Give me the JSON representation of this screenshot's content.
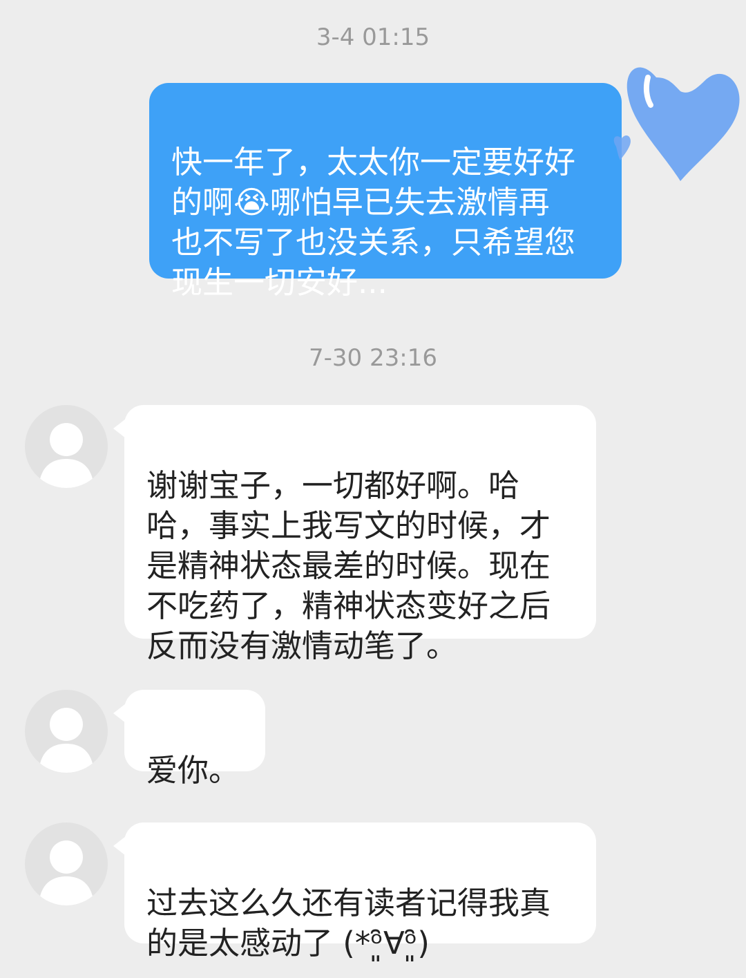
{
  "conversation": {
    "timestamps": {
      "first": "3-4 01:15",
      "second": "7-30 23:16"
    },
    "messages": [
      {
        "direction": "outgoing",
        "text": "快一年了，太太你一定要好好\n的啊😭哪怕早已失去激情再\n也不写了也没关系，只希望您\n现生一切安好..."
      },
      {
        "direction": "incoming",
        "text": "谢谢宝子，一切都好啊。哈\n哈，事实上我写文的时候，才\n是精神状态最差的时候。现在\n不吃药了，精神状态变好之后\n反而没有激情动笔了。"
      },
      {
        "direction": "incoming",
        "text": "爱你。"
      },
      {
        "direction": "incoming",
        "text": "过去这么久还有读者记得我真\n的是太感动了 (*ᵒ͈̑∀ᵒ͈̑)"
      }
    ]
  },
  "icons": {
    "avatar": "default-user-silhouette-icon",
    "sticker": "blue-heart-sticker-icon"
  },
  "colors": {
    "background": "#ededed",
    "outgoing_bubble": "#3ea1f7",
    "incoming_bubble": "#ffffff",
    "timestamp_text": "#999999",
    "heart": "#6fa5f2"
  }
}
